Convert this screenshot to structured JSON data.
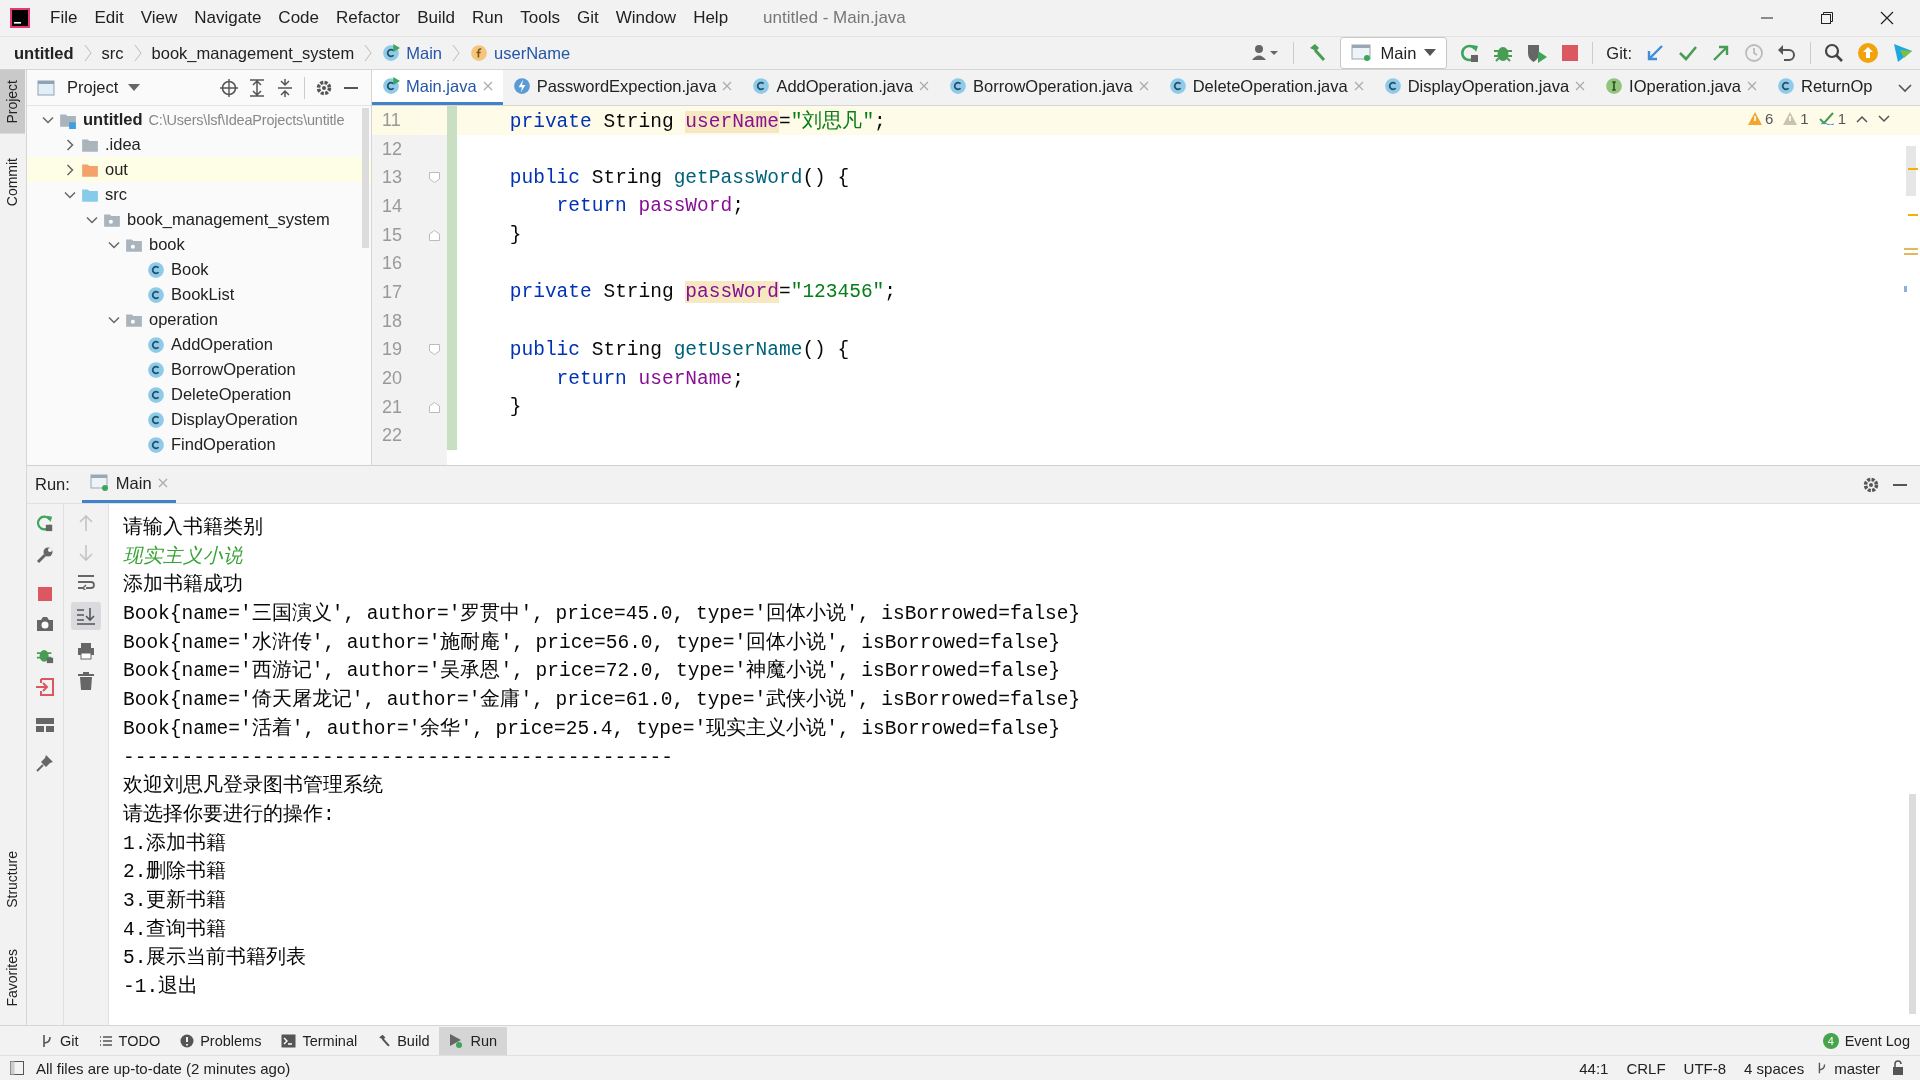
{
  "menu": [
    "File",
    "Edit",
    "View",
    "Navigate",
    "Code",
    "Refactor",
    "Build",
    "Run",
    "Tools",
    "Git",
    "Window",
    "Help"
  ],
  "window": {
    "title": "untitled - Main.java"
  },
  "breadcrumbs": [
    {
      "label": "untitled",
      "kind": "project"
    },
    {
      "label": "src",
      "kind": "plain"
    },
    {
      "label": "book_management_system",
      "kind": "plain"
    },
    {
      "label": "Main",
      "kind": "class-run"
    },
    {
      "label": "userName",
      "kind": "field"
    }
  ],
  "run_config": {
    "label": "Main"
  },
  "git_label": "Git:",
  "side_tools_top": [
    {
      "label": "Project",
      "selected": true
    },
    {
      "label": "Commit",
      "selected": false
    }
  ],
  "side_tools_bottom": [
    {
      "label": "Structure",
      "selected": false
    },
    {
      "label": "Favorites",
      "selected": false
    }
  ],
  "project_panel": {
    "title": "Project"
  },
  "tree": [
    {
      "label": "untitled",
      "path": "C:\\Users\\lsf\\IdeaProjects\\untitle",
      "kind": "module",
      "expanded": true,
      "children": [
        {
          "label": ".idea",
          "kind": "folder",
          "expanded": false
        },
        {
          "label": "out",
          "kind": "excluded",
          "expanded": false
        },
        {
          "label": "src",
          "kind": "source",
          "expanded": true,
          "children": [
            {
              "label": "book_management_system",
              "kind": "package",
              "expanded": true,
              "children": [
                {
                  "label": "book",
                  "kind": "package",
                  "expanded": true,
                  "children": [
                    {
                      "label": "Book",
                      "kind": "class"
                    },
                    {
                      "label": "BookList",
                      "kind": "class"
                    }
                  ]
                },
                {
                  "label": "operation",
                  "kind": "package",
                  "expanded": true,
                  "children": [
                    {
                      "label": "AddOperation",
                      "kind": "class"
                    },
                    {
                      "label": "BorrowOperation",
                      "kind": "class"
                    },
                    {
                      "label": "DeleteOperation",
                      "kind": "class"
                    },
                    {
                      "label": "DisplayOperation",
                      "kind": "class"
                    },
                    {
                      "label": "FindOperation",
                      "kind": "class"
                    }
                  ]
                }
              ]
            }
          ]
        }
      ]
    }
  ],
  "tabs": [
    {
      "label": "Main.java",
      "kind": "class-run",
      "selected": true,
      "closable": true
    },
    {
      "label": "PasswordExpection.java",
      "kind": "exception",
      "selected": false,
      "closable": true
    },
    {
      "label": "AddOperation.java",
      "kind": "class",
      "selected": false,
      "closable": true
    },
    {
      "label": "BorrowOperation.java",
      "kind": "class",
      "selected": false,
      "closable": true
    },
    {
      "label": "DeleteOperation.java",
      "kind": "class",
      "selected": false,
      "closable": true
    },
    {
      "label": "DisplayOperation.java",
      "kind": "class",
      "selected": false,
      "closable": true
    },
    {
      "label": "IOperation.java",
      "kind": "interface",
      "selected": false,
      "closable": true
    },
    {
      "label": "ReturnOp",
      "kind": "class",
      "selected": false,
      "closable": false
    }
  ],
  "inspections": [
    {
      "kind": "warning",
      "count": "6"
    },
    {
      "kind": "weak-warning",
      "count": "1"
    },
    {
      "kind": "typo",
      "count": "1"
    }
  ],
  "code_lines": [
    {
      "number": "11",
      "current": true,
      "tokens": [
        {
          "kind": "keyword",
          "text": "    private"
        },
        {
          "kind": "plain",
          "text": " String "
        },
        {
          "kind": "field-highlight",
          "text": "userName"
        },
        {
          "kind": "plain",
          "text": "="
        },
        {
          "kind": "string",
          "text": "\"刘思凡\""
        },
        {
          "kind": "plain",
          "text": ";"
        }
      ]
    },
    {
      "number": "12",
      "current": false
    },
    {
      "number": "13",
      "current": false,
      "fold": {
        "kind": "start"
      },
      "tokens": [
        {
          "kind": "keyword",
          "text": "    public"
        },
        {
          "kind": "plain",
          "text": " String "
        },
        {
          "kind": "method",
          "text": "getPassWord"
        },
        {
          "kind": "plain",
          "text": "() {"
        }
      ]
    },
    {
      "number": "14",
      "current": false,
      "tokens": [
        {
          "kind": "keyword",
          "text": "        return"
        },
        {
          "kind": "field",
          "text": " passWord"
        },
        {
          "kind": "plain",
          "text": ";"
        }
      ]
    },
    {
      "number": "15",
      "current": false,
      "fold": {
        "kind": "end"
      },
      "tokens": [
        {
          "kind": "plain",
          "text": "    }"
        }
      ]
    },
    {
      "number": "16",
      "current": false
    },
    {
      "number": "17",
      "current": false,
      "tokens": [
        {
          "kind": "keyword",
          "text": "    private"
        },
        {
          "kind": "plain",
          "text": " String "
        },
        {
          "kind": "field-highlight",
          "text": "passWord"
        },
        {
          "kind": "plain",
          "text": "="
        },
        {
          "kind": "string",
          "text": "\"123456\""
        },
        {
          "kind": "plain",
          "text": ";"
        }
      ]
    },
    {
      "number": "18",
      "current": false
    },
    {
      "number": "19",
      "current": false,
      "fold": {
        "kind": "start"
      },
      "tokens": [
        {
          "kind": "keyword",
          "text": "    public"
        },
        {
          "kind": "plain",
          "text": " String "
        },
        {
          "kind": "method",
          "text": "getUserName"
        },
        {
          "kind": "plain",
          "text": "() {"
        }
      ]
    },
    {
      "number": "20",
      "current": false,
      "tokens": [
        {
          "kind": "keyword",
          "text": "        return"
        },
        {
          "kind": "field",
          "text": " userName"
        },
        {
          "kind": "plain",
          "text": ";"
        }
      ]
    },
    {
      "number": "21",
      "current": false,
      "fold": {
        "kind": "end"
      },
      "tokens": [
        {
          "kind": "plain",
          "text": "    }"
        }
      ]
    },
    {
      "number": "22",
      "current": false
    }
  ],
  "run_panel": {
    "label": "Run:",
    "tabs": [
      {
        "label": "Main",
        "selected": true
      }
    ]
  },
  "console": [
    {
      "kind": "output",
      "text": "请输入书籍类别"
    },
    {
      "kind": "input",
      "text": "现实主义小说"
    },
    {
      "kind": "output",
      "text": "添加书籍成功"
    },
    {
      "kind": "output",
      "text": "Book{name='三国演义', author='罗贯中', price=45.0, type='回体小说', isBorrowed=false}"
    },
    {
      "kind": "output",
      "text": "Book{name='水浒传', author='施耐庵', price=56.0, type='回体小说', isBorrowed=false}"
    },
    {
      "kind": "output",
      "text": "Book{name='西游记', author='吴承恩', price=72.0, type='神魔小说', isBorrowed=false}"
    },
    {
      "kind": "output",
      "text": "Book{name='倚天屠龙记', author='金庸', price=61.0, type='武侠小说', isBorrowed=false}"
    },
    {
      "kind": "output",
      "text": "Book{name='活着', author='余华', price=25.4, type='现实主义小说', isBorrowed=false}"
    },
    {
      "kind": "output",
      "text": "-----------------------------------------------"
    },
    {
      "kind": "output",
      "text": "欢迎刘思凡登录图书管理系统"
    },
    {
      "kind": "output",
      "text": "请选择你要进行的操作:"
    },
    {
      "kind": "output",
      "text": "1.添加书籍"
    },
    {
      "kind": "output",
      "text": "2.删除书籍"
    },
    {
      "kind": "output",
      "text": "3.更新书籍"
    },
    {
      "kind": "output",
      "text": "4.查询书籍"
    },
    {
      "kind": "output",
      "text": "5.展示当前书籍列表"
    },
    {
      "kind": "output",
      "text": "-1.退出"
    }
  ],
  "tool_tabs": [
    {
      "label": "Git",
      "kind": "branch",
      "selected": false
    },
    {
      "label": "TODO",
      "kind": "list",
      "selected": false
    },
    {
      "label": "Problems",
      "kind": "info",
      "selected": false
    },
    {
      "label": "Terminal",
      "kind": "terminal",
      "selected": false
    },
    {
      "label": "Build",
      "kind": "hammer",
      "selected": false
    },
    {
      "label": "Run",
      "kind": "run",
      "selected": true
    }
  ],
  "event_log": {
    "label": "Event Log",
    "badge": "4"
  },
  "status_bar": {
    "message": "All files are up-to-date (2 minutes ago)",
    "items": [
      "44:1",
      "CRLF",
      "UTF-8",
      "4 spaces"
    ],
    "branch": "master"
  }
}
